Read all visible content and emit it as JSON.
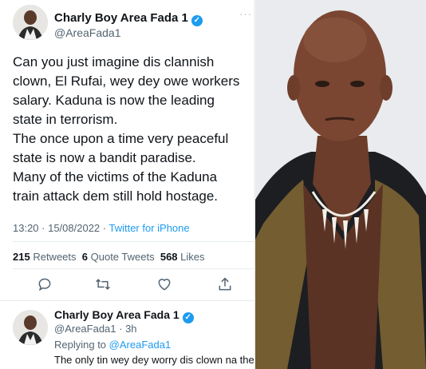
{
  "tweet": {
    "author_name": "Charly Boy Area Fada 1",
    "handle": "@AreaFada1",
    "lines": [
      "Can you just imagine dis clannish",
      "clown, El Rufai, wey dey owe workers",
      "salary. Kaduna is now the leading",
      "state in terrorism.",
      "The once upon a time very peaceful",
      "state is now a bandit paradise.",
      "Many of the victims of the Kaduna",
      "train attack dem still hold hostage."
    ],
    "time": "13:20 · 15/08/2022 · ",
    "source": "Twitter for iPhone",
    "retweets_count": "215",
    "retweets_label": "Retweets",
    "quotes_count": "6",
    "quotes_label": "Quote Tweets",
    "likes_count": "568",
    "likes_label": "Likes"
  },
  "reply": {
    "author_name": "Charly Boy Area Fada 1",
    "handle": "@AreaFada1 · 3h",
    "replying_prefix": "Replying to ",
    "replying_to": "@AreaFada1",
    "text": "The only tin wey dey worry dis clown na the"
  },
  "icons": [
    "verified-icon",
    "more-icon",
    "reply-icon",
    "retweet-icon",
    "like-icon",
    "share-icon"
  ],
  "colors": {
    "accent": "#1d9bf0",
    "secondary_text": "#536471",
    "primary_text": "#0f1419"
  }
}
